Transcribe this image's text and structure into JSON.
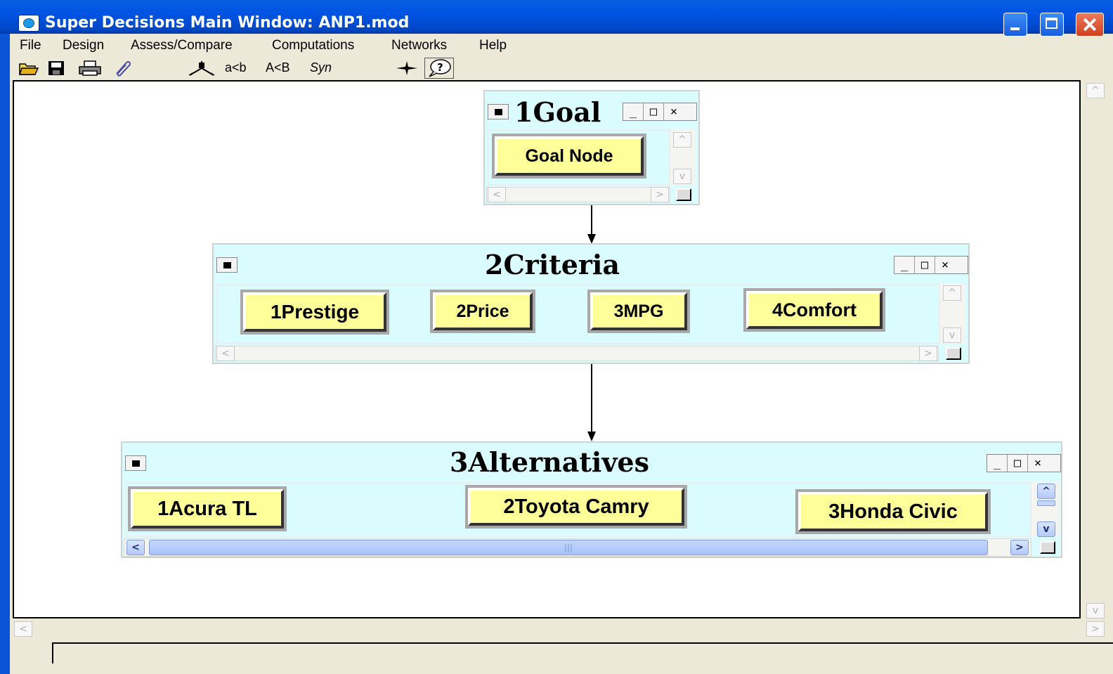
{
  "window": {
    "title": "Super Decisions Main Window: ANP1.mod"
  },
  "menu": {
    "items": [
      {
        "label": "File"
      },
      {
        "label": "Design"
      },
      {
        "label": "Assess/Compare"
      },
      {
        "label": "Computations"
      },
      {
        "label": "Networks"
      },
      {
        "label": "Help"
      }
    ]
  },
  "toolbar": {
    "icons": [
      "open-folder-icon",
      "save-disk-icon",
      "print-icon",
      "paperclip-icon",
      "node-connect-icon",
      "compass-icon",
      "help-balloon-icon"
    ],
    "compare_text_lower": "a<b",
    "compare_text_upper": "A<B",
    "sync_text": "Syn"
  },
  "window_controls": {
    "minimize": "_",
    "maximize": "□",
    "close": "×"
  },
  "clusters": {
    "goal": {
      "title": "1Goal",
      "nodes": [
        {
          "label": "Goal Node"
        }
      ]
    },
    "criteria": {
      "title": "2Criteria",
      "nodes": [
        {
          "label": "1Prestige"
        },
        {
          "label": "2Price"
        },
        {
          "label": "3MPG"
        },
        {
          "label": "4Comfort"
        }
      ]
    },
    "alternatives": {
      "title": "3Alternatives",
      "nodes": [
        {
          "label": "1Acura TL"
        },
        {
          "label": "2Toyota Camry"
        },
        {
          "label": "3Honda Civic"
        }
      ]
    }
  },
  "colors": {
    "titlebar": "#0054e3",
    "cluster_bg": "#dafcff",
    "node_bg": "#ffff99",
    "canvas_bg": "#ffffff"
  }
}
